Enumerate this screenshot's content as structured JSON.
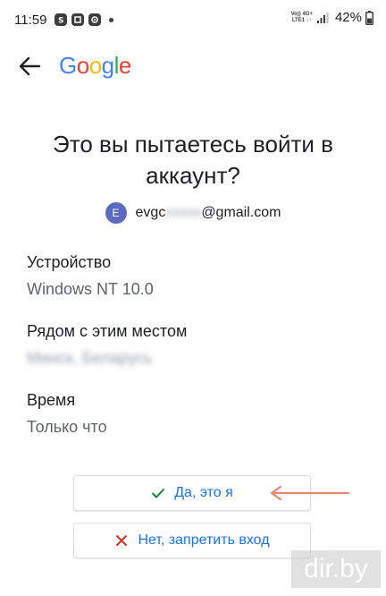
{
  "status_bar": {
    "time": "11:59",
    "net_top": "Vo)) 4G+",
    "net_bottom": "LTE1 ↓↑",
    "battery": "42%"
  },
  "header": {
    "logo_text": "Google"
  },
  "headline": "Это вы пытаетесь войти в аккаунт?",
  "account": {
    "avatar_letter": "E",
    "email_start": "evgc",
    "email_hidden": "xxxxx",
    "email_end": "@gmail.com"
  },
  "details": {
    "device_label": "Устройство",
    "device_value": "Windows NT 10.0",
    "location_label": "Рядом с этим местом",
    "location_value": "Минск, Беларусь",
    "time_label": "Время",
    "time_value": "Только что"
  },
  "actions": {
    "confirm_label": "Да, это я",
    "deny_label": "Нет, запретить вход"
  },
  "watermark": "dir.by",
  "colors": {
    "accent_blue": "#1a73e8",
    "deny_red": "#d93025",
    "confirm_green": "#188038",
    "annotation_arrow": "#e8876a",
    "avatar": "#5c6bc0"
  }
}
